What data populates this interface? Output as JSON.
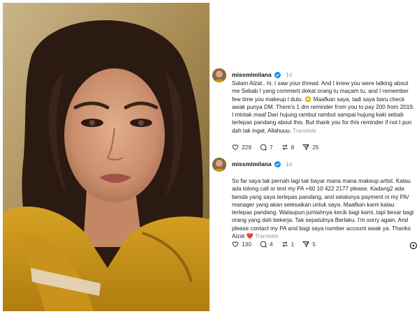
{
  "photo": {
    "alt": ""
  },
  "posts": [
    {
      "username": "missmimilana",
      "time": "1d",
      "text": "Salam Aizat.. hi. I saw your thread. And I knew you were talking about me Sebab I yang comment dekat orang tu maçam tu, and I remember few time you makeup I dulu. 😳 Maafkan saya, tadi saya baru check awak punya DM. There's 1 dm reminder from you to pay 200 from 2019. I mintak maaf Dari hujung rambut rambut sampai hujung kaki sebab terlepas pandang about this. But thank you for this reminder if not I pun dah tak ingat. Allahuuu.",
      "translate": "Translate",
      "likes": "229",
      "replies": "7",
      "reposts": "8",
      "shares": "25"
    },
    {
      "username": "missmimilana",
      "time": "1d",
      "text": "So far saya tak pernah lagi tak bayar mana mana makeup artist. Kalau ada tolong call or text my PA +60 10 422 2177 please. Kadang2 ada benda yang saya terlepas pandang, and selalunya payment ni my PA/ manager yang akan selesaikan untuk saya. Maafkan kami kalau terlepas pandang. Walaupun jumlahnya kecik bagi kami, tapi besar bagi orang yang dah bekerja. Tak sepatutnya Berlaku. I'm sorry again. And please contact my PA and bagi saya number account awak ya. Thanks Aizat ❤️",
      "translate": "Translate",
      "likes": "130",
      "replies": "4",
      "reposts": "1",
      "shares": "5"
    }
  ]
}
